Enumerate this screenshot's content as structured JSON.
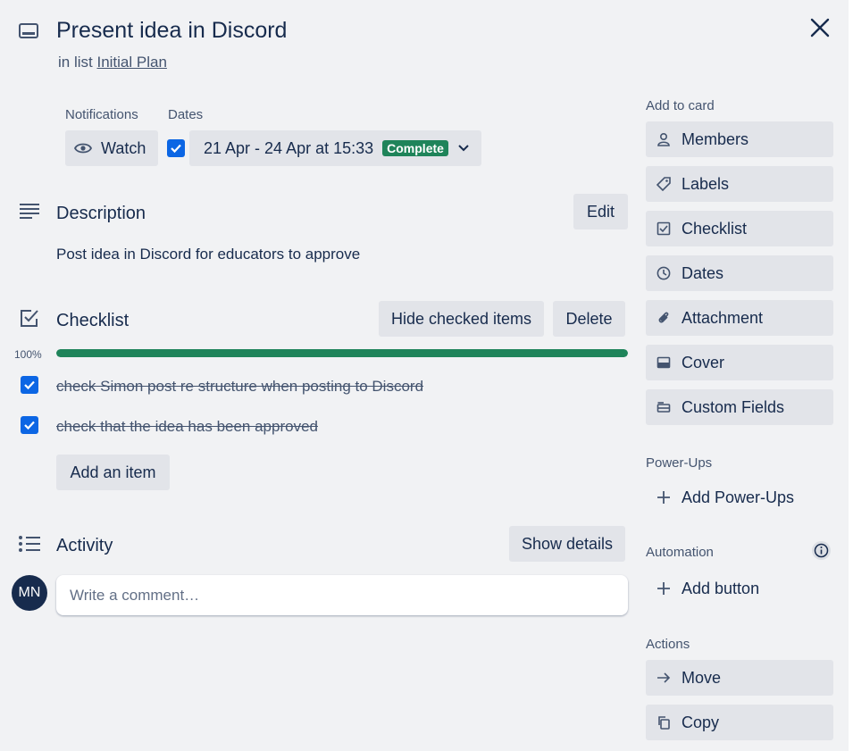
{
  "card": {
    "title": "Present idea in Discord",
    "list_prefix": "in list",
    "list_name": "Initial Plan"
  },
  "notifications": {
    "label": "Notifications",
    "watch_label": "Watch"
  },
  "dates": {
    "label": "Dates",
    "value": "21 Apr - 24 Apr at 15:33",
    "status": "Complete",
    "status_color": "#1f845a"
  },
  "description": {
    "title": "Description",
    "edit_label": "Edit",
    "text": "Post idea in Discord for educators to approve"
  },
  "checklist": {
    "title": "Checklist",
    "hide_label": "Hide checked items",
    "delete_label": "Delete",
    "progress_text": "100%",
    "progress": 1.0,
    "items": [
      {
        "text": "check Simon post re structure when posting to Discord",
        "checked": true
      },
      {
        "text": "check that the idea has been approved",
        "checked": true
      }
    ],
    "add_item_label": "Add an item"
  },
  "activity": {
    "title": "Activity",
    "show_details_label": "Show details",
    "avatar_initials": "MN",
    "comment_placeholder": "Write a comment…"
  },
  "sidebar": {
    "add_to_card_label": "Add to card",
    "add_to_card": [
      {
        "label": "Members",
        "icon": "person-icon"
      },
      {
        "label": "Labels",
        "icon": "tag-icon"
      },
      {
        "label": "Checklist",
        "icon": "checklist-icon"
      },
      {
        "label": "Dates",
        "icon": "clock-icon"
      },
      {
        "label": "Attachment",
        "icon": "paperclip-icon"
      },
      {
        "label": "Cover",
        "icon": "cover-icon"
      },
      {
        "label": "Custom Fields",
        "icon": "custom-fields-icon"
      }
    ],
    "powerups_label": "Power-Ups",
    "add_powerups_label": "Add Power-Ups",
    "automation_label": "Automation",
    "add_button_label": "Add button",
    "actions_label": "Actions",
    "actions": [
      {
        "label": "Move",
        "icon": "arrow-right-icon"
      },
      {
        "label": "Copy",
        "icon": "copy-icon"
      }
    ]
  },
  "colors": {
    "background": "#f1f2f4",
    "button": "#e2e4e9",
    "text": "#172b4d",
    "accent": "#0c66e4",
    "progress": "#1f845a",
    "avatar": "#172b4d"
  }
}
